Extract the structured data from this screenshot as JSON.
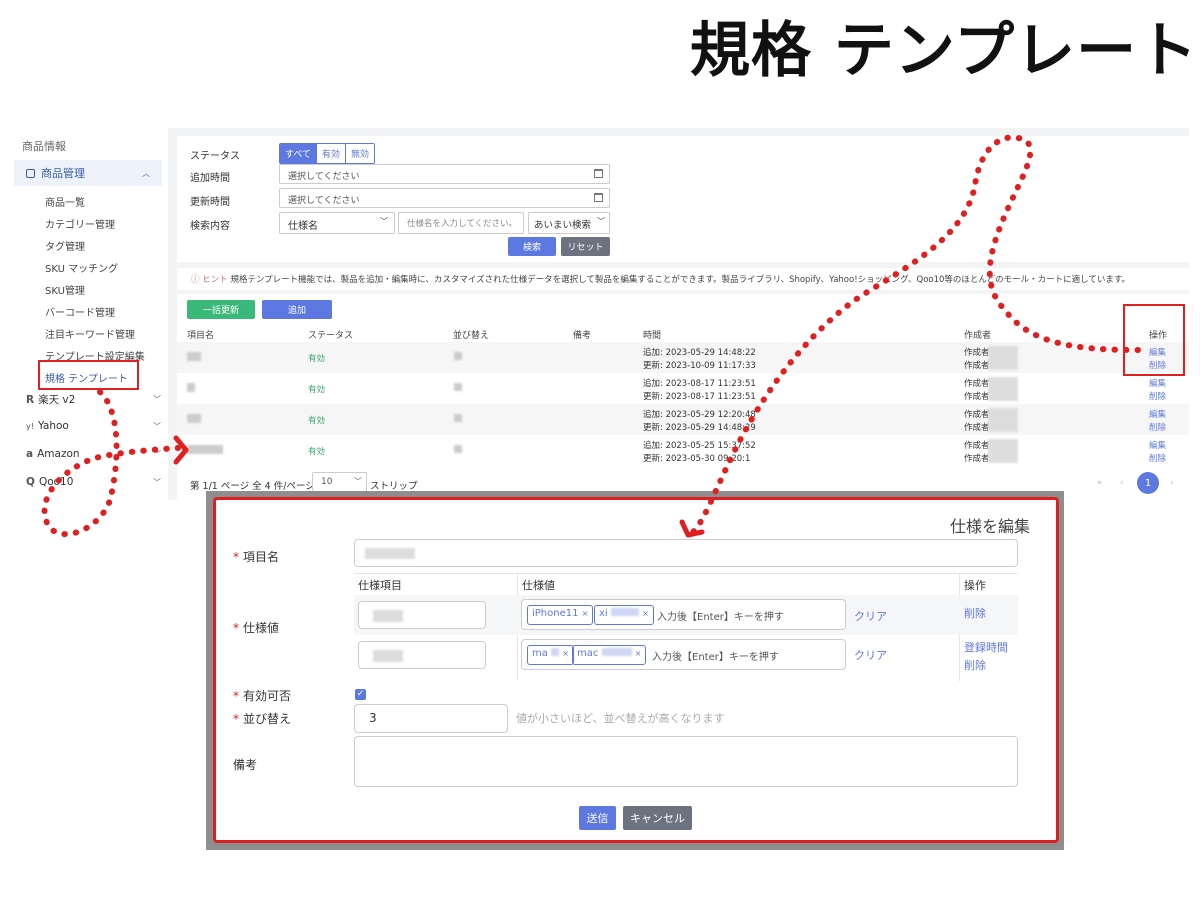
{
  "title": "規格 テンプレート",
  "sidebar": {
    "section": "商品情報",
    "menu": "商品管理",
    "items": [
      "商品一覧",
      "カテゴリー管理",
      "タグ管理",
      "SKU マッチング",
      "SKU管理",
      "バーコード管理",
      "注目キーワード管理",
      "テンプレート設定編集",
      "規格 テンプレート"
    ],
    "platforms": [
      {
        "icon": "R",
        "label": "楽天 v2"
      },
      {
        "icon": "y!",
        "label": "Yahoo"
      },
      {
        "icon": "a",
        "label": "Amazon"
      },
      {
        "icon": "Q",
        "label": "Qoo10"
      }
    ]
  },
  "filters": {
    "status_label": "ステータス",
    "status_options": [
      "すべて",
      "有効",
      "無効"
    ],
    "added_label": "追加時間",
    "added_placeholder": "選択してください",
    "updated_label": "更新時間",
    "updated_placeholder": "選択してください",
    "search_label": "検索内容",
    "search_field": "仕様名",
    "search_placeholder": "仕様名を入力してください。",
    "match_mode": "あいまい検索",
    "search_button": "検索",
    "reset_button": "リセット"
  },
  "hint": {
    "tag": "ヒント",
    "text": "規格テンプレート機能では、製品を追加・編集時に、カスタマイズされた仕様データを選択して製品を編集することができます。製品ライブラリ、Shopify、Yahoo!ショッピング、Qoo10等のほとんどのモール・カートに適しています。"
  },
  "list": {
    "bulk_update": "一括更新",
    "add": "追加",
    "headers": [
      "項目名",
      "ステータス",
      "並び替え",
      "備考",
      "時間",
      "作成者",
      "操作"
    ],
    "rows": [
      {
        "status": "有効",
        "added": "追加: 2023-05-29 14:48:22",
        "updated": "更新: 2023-10-09 11:17:33",
        "creator1": "作成者:",
        "creator2": "作成者:",
        "edit": "編集",
        "delete": "削除"
      },
      {
        "status": "有効",
        "added": "追加: 2023-08-17 11:23:51",
        "updated": "更新: 2023-08-17 11:23:51",
        "creator1": "作成者:",
        "creator2": "作成者:",
        "edit": "編集",
        "delete": "削除"
      },
      {
        "status": "有効",
        "added": "追加: 2023-05-29 12:20:48",
        "updated": "更新: 2023-05-29 14:48:29",
        "creator1": "作成者:",
        "creator2": "作成者:",
        "edit": "編集",
        "delete": "削除"
      },
      {
        "status": "有効",
        "added": "追加: 2023-05-25 15:37:52",
        "updated": "更新: 2023-05-30 09:20:1",
        "creator1": "作成者:",
        "creator2": "作成者:",
        "edit": "編集",
        "delete": "削除"
      }
    ],
    "pagination_text": "第 1/1 ページ 全 4 件/ページ",
    "page_size": "10",
    "strip": "ストリップ",
    "current_page": "1"
  },
  "dialog": {
    "title": "仕様を編集",
    "name_label": "項目名",
    "spec_label": "仕様値",
    "col_item": "仕様項目",
    "col_value": "仕様値",
    "col_action": "操作",
    "row1_tags": [
      "iPhone11",
      "xi"
    ],
    "row2_tags": [
      "ma",
      "mac"
    ],
    "tag_placeholder": "入力後【Enter】キーを押す",
    "clear": "クリア",
    "delete": "削除",
    "register_time": "登録時間",
    "valid_label": "有効可否",
    "sort_label": "並び替え",
    "sort_value": "3",
    "sort_hint": "値が小さいほど、並べ替えが高くなります",
    "notes_label": "備考",
    "submit": "送信",
    "cancel": "キャンセル"
  },
  "colors": {
    "accent": "#5d79e1",
    "green": "#3ab97a",
    "highlight": "#e02020",
    "gray_button": "#6c7280"
  }
}
